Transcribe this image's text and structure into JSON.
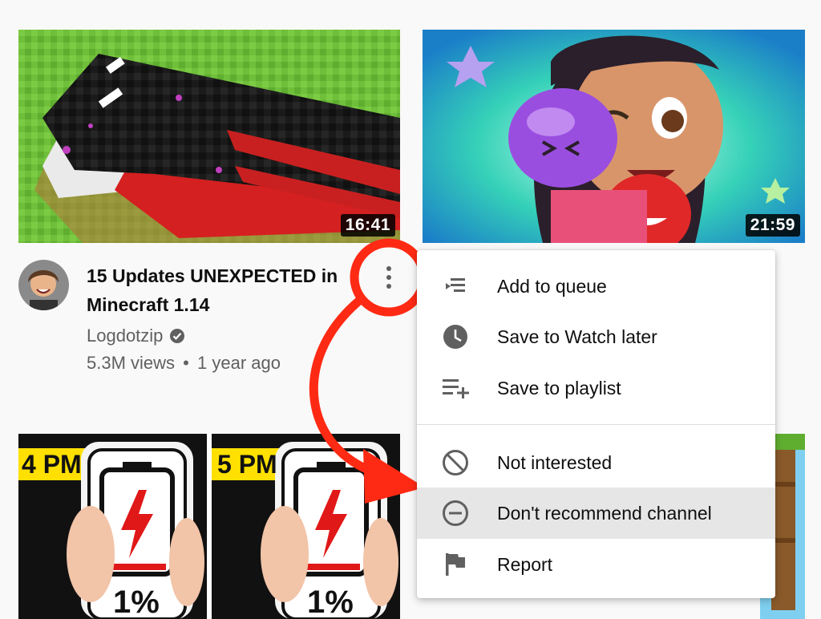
{
  "videos": [
    {
      "duration": "16:41",
      "title": "15 Updates UNEXPECTED in Minecraft 1.14",
      "channel": "Logdotzip",
      "views": "5.3M views",
      "separator": "•",
      "age": "1 year ago"
    },
    {
      "duration": "21:59"
    },
    {
      "badge_left": "4 PM",
      "badge_right": "5 PM",
      "percent_left": "1%",
      "percent_right": "1%"
    }
  ],
  "menu": {
    "items": [
      {
        "label": "Add to queue",
        "icon": "queue-icon"
      },
      {
        "label": "Save to Watch later",
        "icon": "clock-icon"
      },
      {
        "label": "Save to playlist",
        "icon": "playlist-add-icon"
      },
      {
        "label": "Not interested",
        "icon": "block-icon"
      },
      {
        "label": "Don't recommend channel",
        "icon": "minus-circle-icon"
      },
      {
        "label": "Report",
        "icon": "flag-icon"
      }
    ],
    "highlighted_index": 4
  },
  "colors": {
    "annotation_red": "#ff2a14",
    "icon_gray": "#606060",
    "highlight": "#e6e6e6"
  }
}
